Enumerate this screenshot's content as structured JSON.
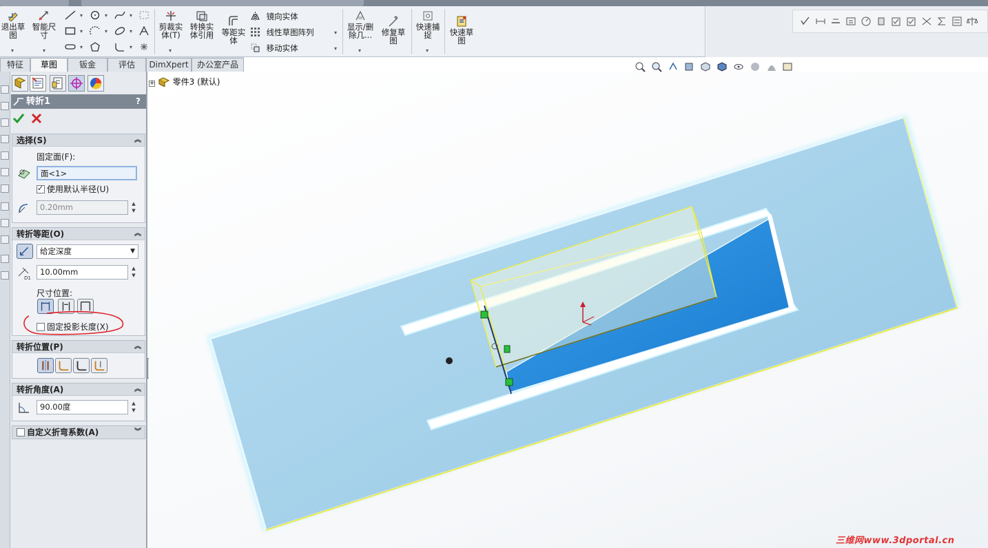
{
  "ribbon": {
    "exit_sketch": "退出草\n图",
    "smart_dim": "智能尺\n寸",
    "trim": "剪裁实\n体(T)",
    "convert": "转换实\n体引用",
    "offset": "等距实\n体",
    "mirror": "镜向实体",
    "linear_pattern": "线性草图阵列",
    "move": "移动实体",
    "show_delete": "显示/删\n除几...",
    "repair": "修复草\n图",
    "quick_snap": "快速捕\n捉",
    "rapid_sketch": "快速草\n图"
  },
  "tabs": [
    {
      "label": "特征"
    },
    {
      "label": "草图"
    },
    {
      "label": "钣金"
    },
    {
      "label": "评估"
    },
    {
      "label": "DimXpert"
    },
    {
      "label": "办公室产品"
    }
  ],
  "panel": {
    "title": "转折1",
    "help": "?",
    "ok_icon": "check-icon",
    "cancel_icon": "x-icon",
    "selection": {
      "header": "选择(S)",
      "fixed_face_label": "固定面(F):",
      "fixed_face_value": "面<1>",
      "use_default_radius": "使用默认半径(U)",
      "radius_value": "0.20mm"
    },
    "offset": {
      "header": "转折等距(O)",
      "end_condition": "给定深度",
      "distance": "10.00mm",
      "dim_position_label": "尺寸位置:",
      "fix_projected_length": "固定投影长度(X)"
    },
    "position": {
      "header": "转折位置(P)"
    },
    "angle": {
      "header": "转折角度(A)",
      "value": "90.00度"
    },
    "custom_bend": {
      "header": "自定义折弯系数(A)"
    }
  },
  "tree": {
    "root": "零件3  (默认)"
  },
  "watermark": "三维网www.3dportal.cn",
  "colors": {
    "panel_header": "#7d8794",
    "plate": "#a9d3ec",
    "pocket": "#2c8ed9",
    "highlight_yellow": "#f2f27a",
    "annotation_red": "#e0202a"
  }
}
